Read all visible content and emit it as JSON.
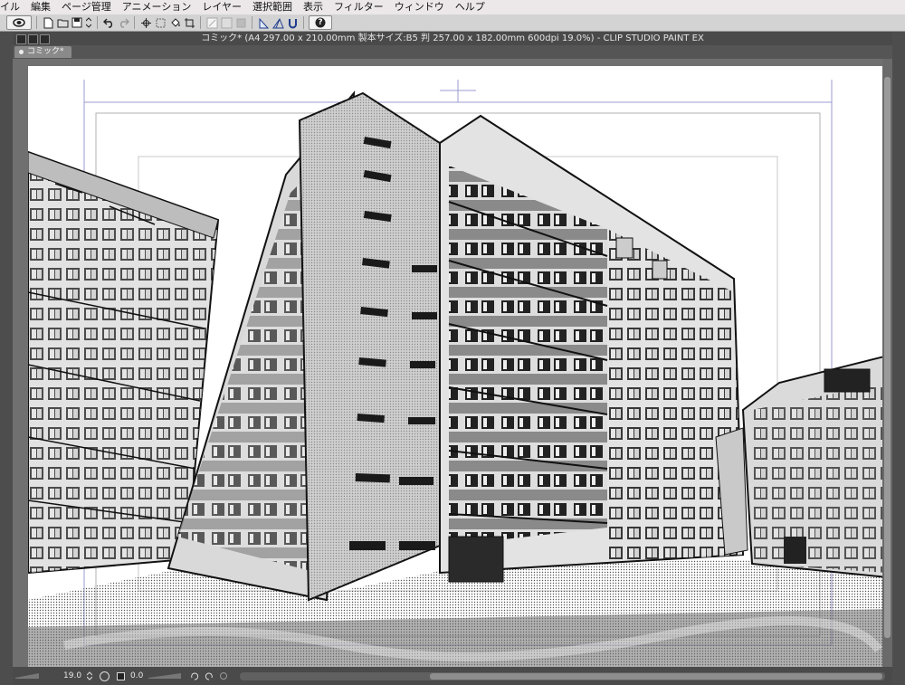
{
  "menubar": {
    "items": [
      "イル",
      "編集",
      "ページ管理",
      "アニメーション",
      "レイヤー",
      "選択範囲",
      "表示",
      "フィルター",
      "ウィンドウ",
      "ヘルプ"
    ]
  },
  "toolbar": {
    "help_label": "?"
  },
  "window": {
    "title": "コミック* (A4 297.00 x 210.00mm 製本サイズ:B5 判 257.00 x 182.00mm 600dpi 19.0%)  - CLIP STUDIO PAINT EX"
  },
  "tab": {
    "label": "コミック*"
  },
  "status": {
    "zoom": "19.0",
    "rotation": "0.0"
  },
  "colors": {
    "menubar_bg": "#ece8ea",
    "toolbar_bg": "#d3d3d3",
    "window_bg": "#4a4a4a",
    "canvas_bg": "#707070",
    "guide_line": "#8e8ec8"
  },
  "icons": {
    "toolbar": [
      "clip-studio-icon",
      "new-file-icon",
      "open-file-icon",
      "save-icon",
      "undo-icon",
      "redo-icon",
      "transform-icon",
      "selection-icon",
      "fill-icon",
      "crop-icon",
      "ruler-icon",
      "perspective-ruler-icon",
      "snap-icon",
      "help-icon"
    ]
  }
}
